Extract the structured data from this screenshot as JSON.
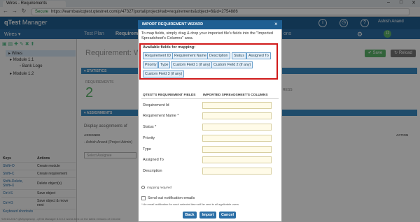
{
  "browser": {
    "tab_title": "Wires - Requirements",
    "secure_label": "Secure",
    "url": "https://learnbasicqtest.qtestnet.com/p/47327/portal/project#tab=requirements&object=6&id=2754886",
    "user_initial": "Ashish"
  },
  "app": {
    "logo_q": "qTest",
    "logo_rest": " Manager",
    "user_name": "Ashish Anand",
    "project": "Wires",
    "nav": [
      "Test Plan",
      "Requirements",
      "ons"
    ],
    "badge": "12"
  },
  "left": {
    "tree": [
      "Wires",
      "Module 1.1",
      "Bank Logo",
      "Module 1.2"
    ],
    "keys_header": [
      "Keys",
      "Actions"
    ],
    "keys": [
      [
        "Shift+O",
        "Create module"
      ],
      [
        "Shift+C",
        "Create requirement"
      ],
      [
        "Shift+Delete, Shift+X",
        "Delete object(s)"
      ],
      [
        "Ctrl+S",
        "Save object"
      ],
      [
        "Ctrl+G",
        "Save object & move next"
      ]
    ],
    "shortcuts_link": "Keyboard shortcuts",
    "footer": "©2010-2017 QASymphony - qTest Manager 8.5.0.2 works best on the latest versions of Chrome"
  },
  "main": {
    "title": "Requirement: W",
    "save_label": "Save",
    "reload_label": "Reload",
    "statistics_label": "STATISTICS",
    "requirements_label": "REQUIREMENTS",
    "requirements_count": "2",
    "progress_label": "RESS",
    "assignments_label": "ASSIGNMENTS",
    "display_label": "Display assignments of",
    "assignee_label": "ASSIGNEE",
    "assignee_value": "- Ashish Anand (Project Admin)",
    "select_placeholder": "Select Assignee",
    "action_label": "ACTION"
  },
  "modal": {
    "title": "IMPORT REQUIREMENT WIZARD",
    "close": "×",
    "instruction": "To map fields, simply drag & drop your imported file's fields into the \"Imported Spreadsheet's Columns\" area.",
    "available_label": "Available fields for mapping:",
    "chips": [
      "Requirement ID",
      "Requirement Name",
      "Description",
      "Status",
      "Assigned To",
      "Priority",
      "Type",
      "Custom Field 1 (if any)",
      "Custom Field 2 (if any)",
      "Custom Field 3 (if any)"
    ],
    "col1": "QTEST'S REQUIREMENT FIELDS",
    "col2": "IMPORTED SPREADSHEET'S COLUMNS",
    "rows": [
      "Requirement Id",
      "Requirement Name *",
      "Status *",
      "Priority",
      "Type",
      "Assigned To",
      "Description"
    ],
    "mapping_required": "mapping required",
    "send_notification": "Send out notification emails",
    "note": "* An email notification for each selected item will be sent to all applicable users",
    "back": "Back",
    "import": "Import",
    "cancel": "Cancel"
  }
}
